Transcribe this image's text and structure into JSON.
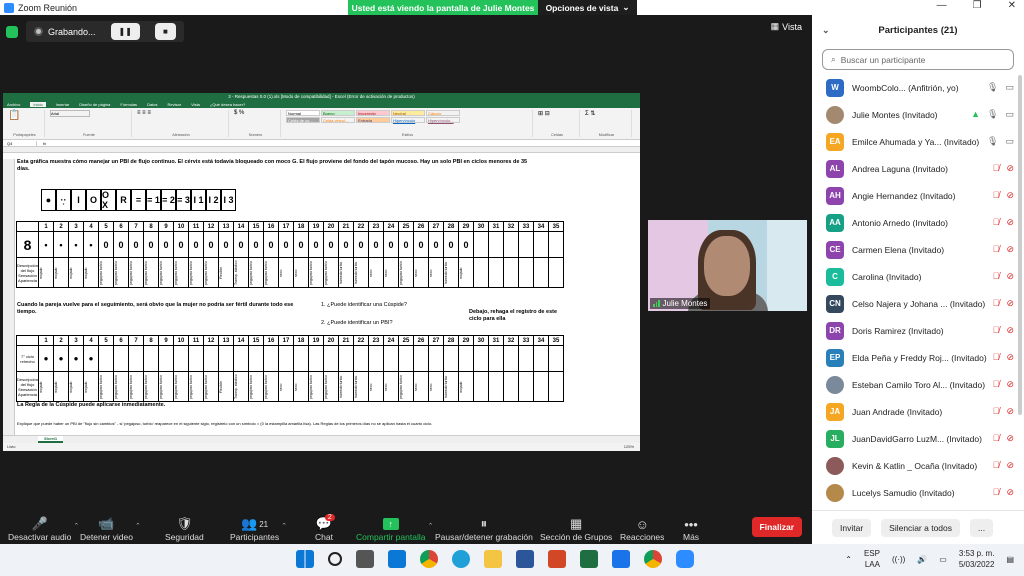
{
  "window": {
    "title": "Zoom Reunión",
    "controls": [
      "—",
      "❐",
      "✕"
    ]
  },
  "share_banner": {
    "message": "Usted está viendo la pantalla de Julie Montes",
    "view_options": "Opciones de vista"
  },
  "recording": {
    "label": "Grabando..."
  },
  "view_button": "Vista",
  "excel": {
    "title": "3 - Respuestas 0.0 (1).xls [Modo de compatibilidad] - Excel (Error de activación de productos)",
    "tabs": [
      "Archivo",
      "Inicio",
      "Insertar",
      "Diseño de página",
      "Fórmulas",
      "Datos",
      "Revisar",
      "Vista",
      "¿Qué desea hacer?"
    ],
    "font_name": "Arial",
    "styles": [
      "Normal",
      "Bueno",
      "Incorrecto",
      "Neutral",
      "Cálculo",
      "Celda de co...",
      "Celda vincul...",
      "Entrada",
      "Hipervínculo",
      "Hipervínculo..."
    ],
    "ribbon_groups": [
      "Portapapeles",
      "Fuente",
      "Alineación",
      "Número",
      "Estilos",
      "Celdas",
      "Modificar"
    ],
    "name_box": "Q4",
    "row1_text": "Esta gráfica muestra cómo manejar un PBI de flujo continuo. El cérvix está todavía bloqueado con moco G. El flujo proviene del fondo del tapón mucoso. Hay un solo PBI en ciclos menores de 35 días.",
    "symbols": [
      "●",
      "·̣·",
      "I",
      "O",
      "O X",
      "R",
      "=",
      "= 1",
      "= 2",
      "= 3",
      "I 1",
      "I 2",
      "I 3"
    ],
    "numbers": [
      "1",
      "2",
      "3",
      "4",
      "5",
      "6",
      "7",
      "8",
      "9",
      "10",
      "11",
      "12",
      "13",
      "14",
      "15",
      "16",
      "17",
      "18",
      "19",
      "20",
      "21",
      "22",
      "23",
      "24",
      "25",
      "26",
      "27",
      "28",
      "29",
      "30",
      "31",
      "32",
      "33",
      "34",
      "35"
    ],
    "big_number": "8",
    "row6_marks": [
      "•",
      "•",
      "•",
      "•",
      "0",
      "0",
      "0",
      "0",
      "0",
      "0",
      "0",
      "0",
      "0",
      "0",
      "0",
      "0",
      "0",
      "0",
      "0",
      "0",
      "0",
      "0",
      "0",
      "0",
      "0",
      "0",
      "0",
      "0",
      "0"
    ],
    "desc_label": "Descripción del flujo Sensación Apariencia",
    "desc_values": [
      "mojado",
      "mojado",
      "mojado",
      "mojado",
      "pegajoso turbio",
      "pegajoso turbio",
      "pegajoso turbio",
      "pegajoso turbio",
      "pegajoso turbio",
      "pegajoso turbio",
      "pegajoso turbio",
      "pegajoso turbio",
      "Flexible",
      "Transp. elástico",
      "pegajoso turbio",
      "pegajoso turbio",
      "seco",
      "seco",
      "pegajoso turbio",
      "pegajoso turbio",
      "húmedo turbio",
      "húmedo turbio",
      "seco",
      "seco",
      "pegajoso turbio",
      "seco",
      "seco",
      "húmedo turbio",
      "mojado"
    ],
    "row8_text": "Cuando la pareja vuelve para el seguimiento, será obvio que la mujer no podría ser fértil durante todo ese tiempo.",
    "q1": "1. ¿Puede identificar una Cúspide?",
    "q2": "2. ¿Puede identificar un PBI?",
    "note": "Debajo, rehaga el registro de este ciclo para ella",
    "cycle_label": "7° ciclo rehecho",
    "row13_text": "La Regla de la Cúspide puede aplicarse inmediatamente.",
    "row14_text": "Explique que puede haber un PBI de \"flujo sin cambios\" - si 'pegajoso, turbio' reaparece en el siguiente siglo, registrelo con un símbolo = (0 la estampilla amarilla lisa). Las Reglas de los primeros días no se aplican hasta el cuarto ciclo.",
    "sheet_tab": "Sheet1",
    "status": "Listo",
    "zoom": "125%"
  },
  "camera": {
    "name": "Julie Montes"
  },
  "toolbar": {
    "items": [
      {
        "label": "Desactivar audio",
        "icon": "🎤"
      },
      {
        "label": "Detener video",
        "icon": "📹"
      },
      {
        "label": "Seguridad",
        "icon": "🛡"
      },
      {
        "label": "Participantes",
        "icon": "👥",
        "count": "21"
      },
      {
        "label": "Chat",
        "icon": "💬",
        "badge": "2"
      },
      {
        "label": "Compartir pantalla",
        "icon": "↑"
      },
      {
        "label": "Pausar/detener grabación",
        "icon": "⏸"
      },
      {
        "label": "Sección de Grupos",
        "icon": "▦"
      },
      {
        "label": "Reacciones",
        "icon": "☺"
      },
      {
        "label": "Más",
        "icon": "•••"
      }
    ],
    "end": "Finalizar"
  },
  "participants": {
    "header": "Participantes (21)",
    "search_placeholder": "Buscar un participante",
    "list": [
      {
        "initials": "W",
        "name": "WoombColo...",
        "role": " (Anfitrión, yo)",
        "color": "#2d6bc4",
        "muted": false
      },
      {
        "initials": "",
        "name": "Julie Montes",
        "role": " (Invitado)",
        "color": "#a38970",
        "muted": false,
        "sharing": true
      },
      {
        "initials": "EA",
        "name": "Emilce Ahumada y Ya...",
        "role": " (Invitado)",
        "color": "#f5a623",
        "muted": false
      },
      {
        "initials": "AL",
        "name": "Andrea Laguna",
        "role": " (Invitado)",
        "color": "#8e44ad",
        "muted": true
      },
      {
        "initials": "AH",
        "name": "Angie Hernandez",
        "role": " (Invitado)",
        "color": "#8e44ad",
        "muted": true
      },
      {
        "initials": "AA",
        "name": "Antonio Arnedo",
        "role": " (Invitado)",
        "color": "#16a085",
        "muted": true
      },
      {
        "initials": "CE",
        "name": "Carmen Elena",
        "role": " (Invitado)",
        "color": "#8e44ad",
        "muted": true
      },
      {
        "initials": "C",
        "name": "Carolina",
        "role": " (Invitado)",
        "color": "#1abc9c",
        "muted": true
      },
      {
        "initials": "CN",
        "name": "Celso Najera y Johana ...",
        "role": " (Invitado)",
        "color": "#34495e",
        "muted": true
      },
      {
        "initials": "DR",
        "name": "Doris Ramirez",
        "role": " (Invitado)",
        "color": "#8e44ad",
        "muted": true
      },
      {
        "initials": "EP",
        "name": "Elda Peña y Freddy Roj...",
        "role": " (Invitado)",
        "color": "#2980b9",
        "muted": true
      },
      {
        "initials": "",
        "name": "Esteban Camilo Toro Al...",
        "role": " (Invitado)",
        "color": "#7a8a9a",
        "muted": true
      },
      {
        "initials": "JA",
        "name": "Juan Andrade",
        "role": " (Invitado)",
        "color": "#f5a623",
        "muted": true
      },
      {
        "initials": "JL",
        "name": "JuanDavidGarro LuzM...",
        "role": " (Invitado)",
        "color": "#27ae60",
        "muted": true
      },
      {
        "initials": "",
        "name": "Kevin & Katlin _ Ocaña",
        "role": " (Invitado)",
        "color": "#8c5a5a",
        "muted": true
      },
      {
        "initials": "",
        "name": "Lucelys Samudio",
        "role": " (Invitado)",
        "color": "#b5894a",
        "muted": true
      }
    ],
    "invite": "Invitar",
    "mute_all": "Silenciar a todos",
    "more": "..."
  },
  "taskbar": {
    "lang": "ESP",
    "lang2": "LAA",
    "time": "3:53 p. m.",
    "date": "5/03/2022"
  }
}
